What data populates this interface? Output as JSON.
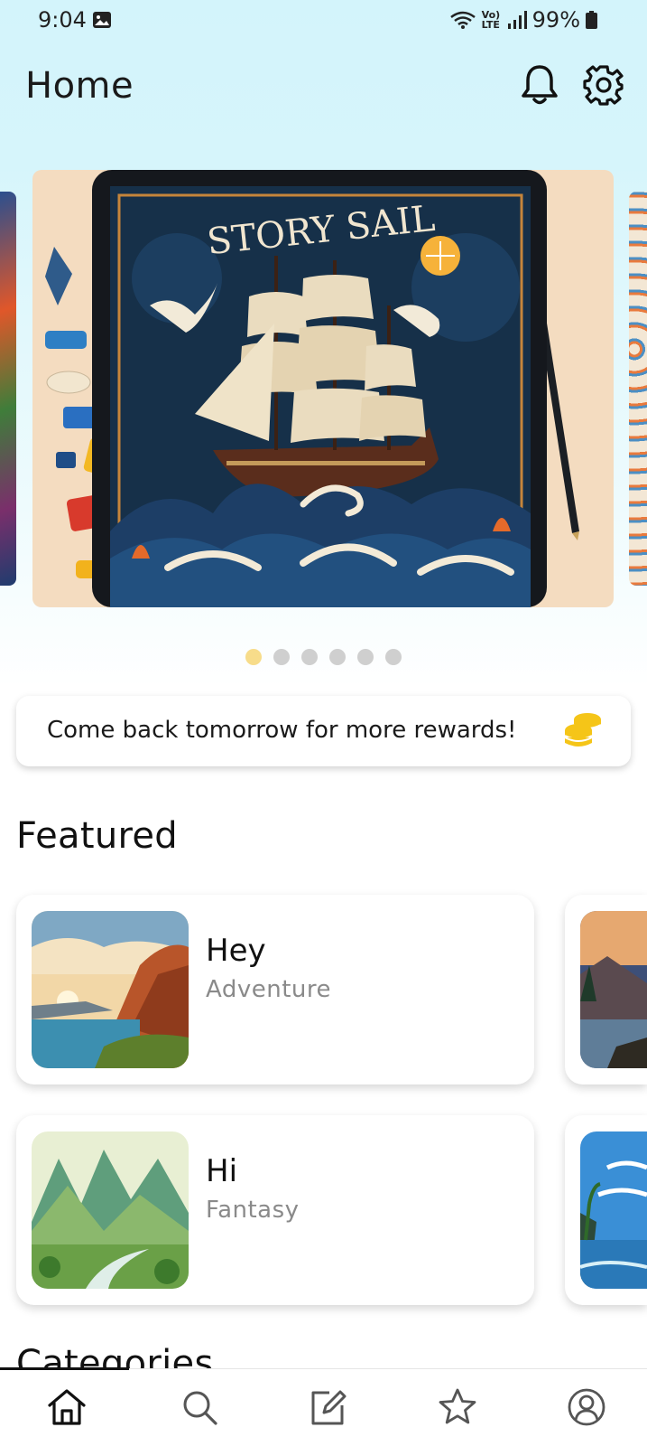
{
  "status_bar": {
    "time": "9:04",
    "network": "Vo) LTE",
    "battery": "99%"
  },
  "header": {
    "title": "Home",
    "icons": [
      "bell-icon",
      "gear-icon"
    ]
  },
  "carousel": {
    "hero_title": "STORY SAIL",
    "slide_count": 6,
    "active_index": 0
  },
  "reward": {
    "text": "Come back tomorrow for more rewards!",
    "icon": "coins-icon"
  },
  "featured": {
    "title": "Featured",
    "items": [
      {
        "name": "Hey",
        "genre": "Adventure"
      },
      {
        "name": "Hi",
        "genre": "Fantasy"
      }
    ]
  },
  "categories": {
    "title": "Categories"
  },
  "bottom_nav": {
    "items": [
      "home-icon",
      "search-icon",
      "write-icon",
      "star-icon",
      "profile-icon"
    ],
    "active": "home-icon"
  },
  "colors": {
    "header_bg": "#d3f4fb",
    "active_dot": "#f7dc8a",
    "coin": "#f5c518"
  }
}
